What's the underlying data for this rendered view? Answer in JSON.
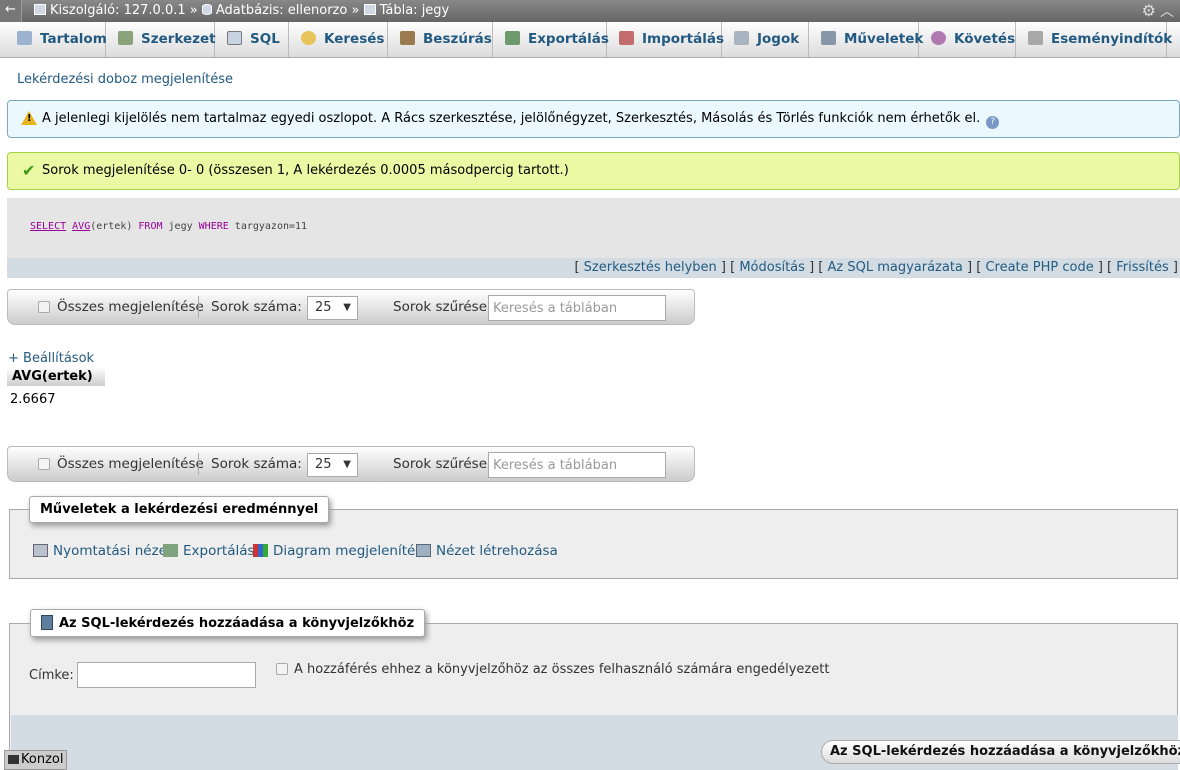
{
  "breadcrumb": {
    "server": "Kiszolgáló: 127.0.0.1",
    "database": "Adatbázis: ellenorzo",
    "table": "Tábla: jegy",
    "separator": "»"
  },
  "tabs": [
    {
      "label": "Tartalom",
      "icon": "browse-icon"
    },
    {
      "label": "Szerkezet",
      "icon": "structure-icon"
    },
    {
      "label": "SQL",
      "icon": "sql-icon"
    },
    {
      "label": "Keresés",
      "icon": "search-icon"
    },
    {
      "label": "Beszúrás",
      "icon": "insert-icon"
    },
    {
      "label": "Exportálás",
      "icon": "export-icon"
    },
    {
      "label": "Importálás",
      "icon": "import-icon"
    },
    {
      "label": "Jogok",
      "icon": "privileges-icon"
    },
    {
      "label": "Műveletek",
      "icon": "wrench-icon"
    },
    {
      "label": "Követés",
      "icon": "eye-icon"
    },
    {
      "label": "Eseményindítók",
      "icon": "triggers-icon"
    }
  ],
  "query_box_link": "Lekérdezési doboz megjelenítése",
  "warning": "A jelenlegi kijelölés nem tartalmaz egyedi oszlopot. A Rács szerkesztése, jelölőnégyzet, Szerkesztés, Másolás és Törlés funkciók nem érhetők el.",
  "success": "Sorok megjelenítése 0- 0 (összesen 1, A lekérdezés 0.0005 másodpercig tartott.)",
  "sql": {
    "select": "SELECT",
    "avg": "AVG",
    "args": "(ertek)",
    "from": "FROM",
    "table": "jegy",
    "where": "WHERE",
    "cond": "targyazon=11"
  },
  "sql_links": {
    "edit_inline": "Szerkesztés helyben",
    "edit": "Módosítás",
    "explain": "Az SQL magyarázata",
    "php": "Create PHP code",
    "refresh": "Frissítés"
  },
  "navbar": {
    "show_all": "Összes megjelenítése",
    "rows_label": "Sorok száma:",
    "rows_value": "25",
    "filter_label": "Sorok szűrése:",
    "filter_placeholder": "Keresés a táblában"
  },
  "settings_link": "+ Beállítások",
  "results": {
    "columns": [
      "AVG(ertek)"
    ],
    "rows": [
      [
        "2.6667"
      ]
    ]
  },
  "operations": {
    "legend": "Műveletek a lekérdezési eredménnyel",
    "print": "Nyomtatási nézet",
    "export": "Exportálás",
    "chart": "Diagram megjelenítése",
    "create_view": "Nézet létrehozása"
  },
  "bookmark": {
    "legend": "Az SQL-lekérdezés hozzáadása a könyvjelzőkhöz",
    "label": "Címke:",
    "label_value": "",
    "share_label": "A hozzáférés ehhez a könyvjelzőhöz az összes felhasználó számára engedélyezett",
    "submit": "Az SQL-lekérdezés hozzáadása a könyvjelzőkhöz"
  },
  "console": "Konzol",
  "colors": {
    "link": "#235a81",
    "warning_bg": "#ebf8fd",
    "success_bg": "#ebf8a4",
    "keyword": "#990099"
  }
}
